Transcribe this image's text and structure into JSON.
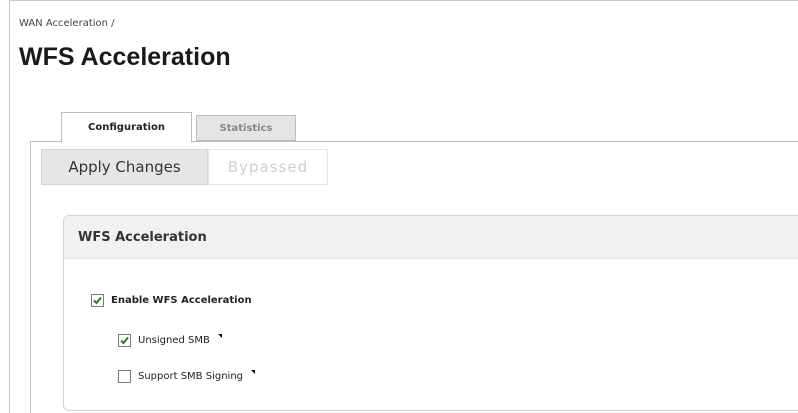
{
  "breadcrumb": "WAN Acceleration /",
  "page_title": "WFS Acceleration",
  "tabs": [
    {
      "label": "Configuration",
      "active": true
    },
    {
      "label": "Statistics",
      "active": false
    }
  ],
  "toolbar": {
    "apply_label": "Apply Changes",
    "bypassed_label": "Bypassed"
  },
  "panel": {
    "title": "WFS Acceleration",
    "options": [
      {
        "label": "Enable WFS Acceleration",
        "checked": true
      },
      {
        "label": "Unsigned SMB",
        "checked": true
      },
      {
        "label": "Support SMB Signing",
        "checked": false
      }
    ]
  },
  "colors": {
    "check": "#2d7a1e"
  }
}
